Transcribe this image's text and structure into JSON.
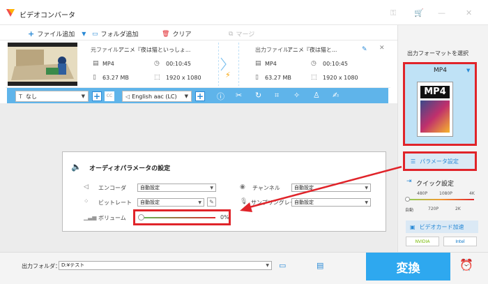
{
  "window": {
    "title": "ビデオコンバータ"
  },
  "toolbar": {
    "add_file": "ファイル追加",
    "add_folder": "フォルダ追加",
    "clear": "クリア",
    "merge": "マージ"
  },
  "file": {
    "source_label": "元ファイル：",
    "source_name": "アニメ『夜は猫といっしょ...",
    "output_label": "出力ファイル：",
    "output_name": "アニメ『夜は猫と...",
    "src_format": "MP4",
    "src_duration": "00:10:45",
    "src_size": "63.27 MB",
    "src_resolution": "1920 x 1080",
    "out_format": "MP4",
    "out_duration": "00:10:45",
    "out_size": "63.27 MB",
    "out_resolution": "1920 x 1080"
  },
  "bar": {
    "subtitle": "なし",
    "cc": "CC",
    "audio_track": "English aac (LC)"
  },
  "audio_panel": {
    "title": "オーディオパラメータの設定",
    "encoder_label": "エンコーダ",
    "encoder_value": "自動設定",
    "bitrate_label": "ビットレート",
    "bitrate_value": "自動設定",
    "volume_label": "ボリューム",
    "volume_value": "0%",
    "volume_fraction": 0,
    "channel_label": "チャンネル",
    "channel_value": "自動設定",
    "sample_label": "サンプリングレート",
    "sample_value": "自動設定"
  },
  "right_panel": {
    "format_title": "出力フォーマットを選択",
    "format_name": "MP4",
    "format_icon_text": "MP4",
    "param_button": "パラメータ設定",
    "quick_title": "クイック設定",
    "quick_top": [
      "480P",
      "1080P",
      "4K"
    ],
    "quick_bottom": [
      "自動",
      "720P",
      "2K"
    ],
    "gpu_title": "ビデオカード加速",
    "nvidia": "NVIDIA",
    "intel": "Intel"
  },
  "bottom": {
    "output_folder_label": "出力フォルダ：",
    "output_folder_value": "D:¥テスト",
    "convert": "変換"
  },
  "colors": {
    "accent": "#2ea8ef",
    "highlight": "#e0242a",
    "bar": "#5fb4ea"
  }
}
